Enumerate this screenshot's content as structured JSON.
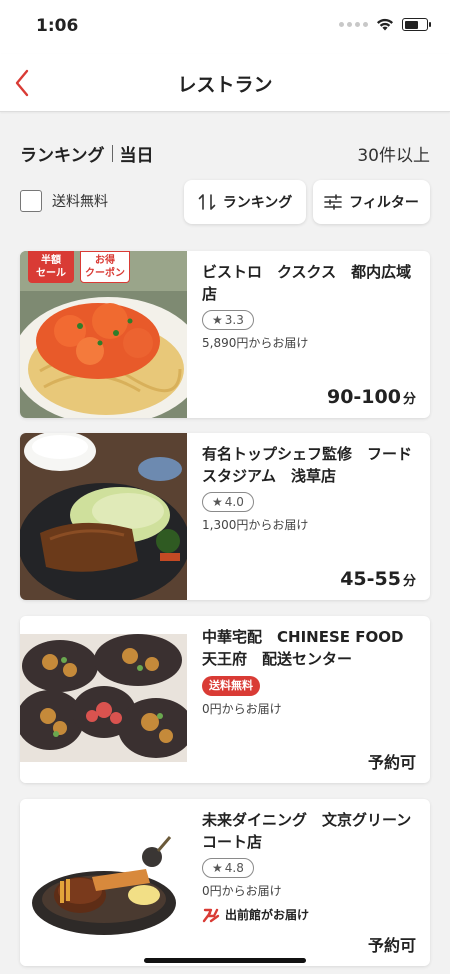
{
  "status_bar": {
    "time": "1:06"
  },
  "nav": {
    "title": "レストラン"
  },
  "list_header": {
    "sort_label": "ランキング",
    "date_label": "当日",
    "count": "30件以上"
  },
  "filters": {
    "free_shipping_label": "送料無料",
    "ranking_button": "ランキング",
    "filter_button": "フィルター"
  },
  "colors": {
    "accent": "#d93b35",
    "background": "#f2f2f2"
  },
  "restaurants": [
    {
      "name": "ビストロ　クスクス　都内広域店",
      "badges": [
        "半額\nセール",
        "お得\nクーポン"
      ],
      "rating": "3.3",
      "min_order": "5,890円からお届け",
      "eta": "90-100",
      "eta_unit": "分"
    },
    {
      "name": "有名トップシェフ監修　フードスタジアム　浅草店",
      "rating": "4.0",
      "min_order": "1,300円からお届け",
      "eta": "45-55",
      "eta_unit": "分"
    },
    {
      "name": "中華宅配　CHINESE FOOD 天王府　配送センター",
      "free_badge": "送料無料",
      "min_order": "0円からお届け",
      "status": "予約可"
    },
    {
      "name": "未来ダイニング　文京グリーンコート店",
      "rating": "4.8",
      "min_order": "0円からお届け",
      "partner": "出前館がお届け",
      "status": "予約可"
    }
  ]
}
